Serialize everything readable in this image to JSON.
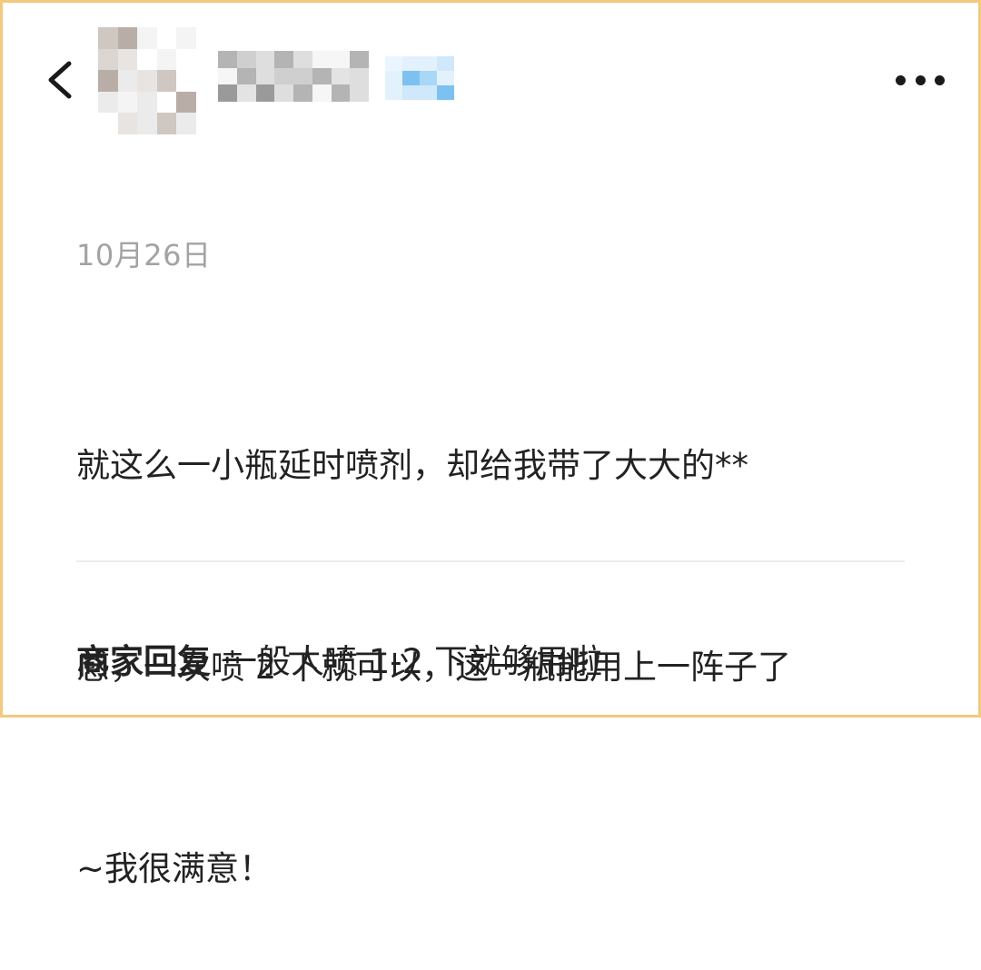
{
  "header": {
    "back_icon": "chevron-left-icon",
    "avatar": "blurred-avatar",
    "nickname": "blurred-nickname",
    "badge": "blurred-badge",
    "more_icon": "more-horizontal-icon"
  },
  "review": {
    "date": "10月26日",
    "text_lines": [
      "就这么一小瓶延时喷剂，却给我带了大大的**",
      "感，一次喷 2 下就可以，这一瓶能用上一阵子了",
      "~我很满意！"
    ]
  },
  "merchant_reply": {
    "label": "商家回复",
    "text": "一般人喷 1-2 下就够用啦"
  },
  "colors": {
    "frame_border": "#f2c97d",
    "date_gray": "#a3a3a3",
    "text": "#222222",
    "divider": "#ececec"
  }
}
